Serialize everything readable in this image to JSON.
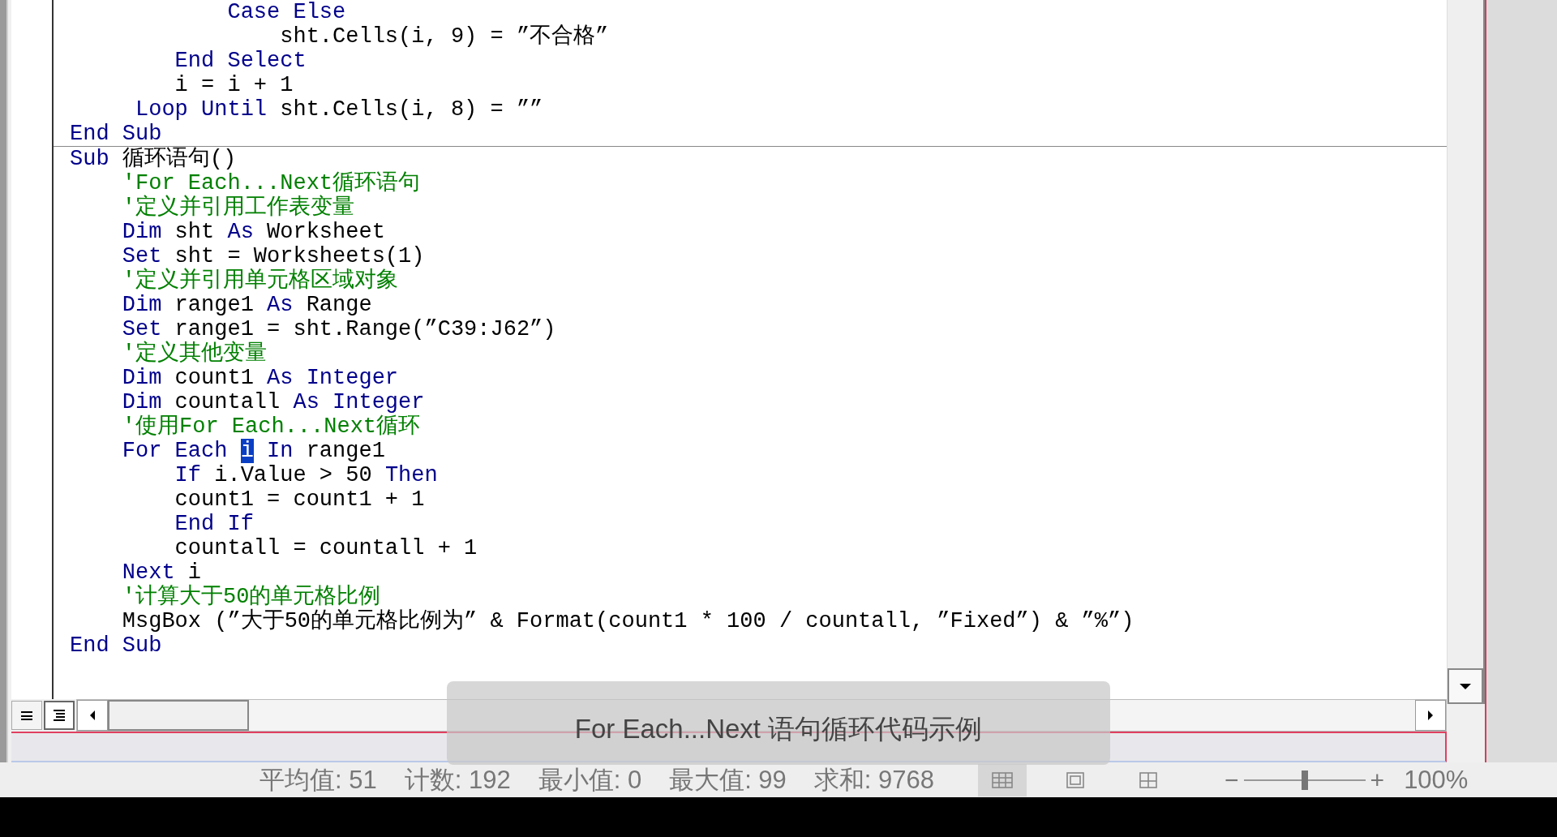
{
  "code_window": {
    "procedures": [
      {
        "lines": [
          [
            {
              "kind": "keyword",
              "text": "            Case Else"
            }
          ],
          [
            {
              "kind": "plain",
              "text": "                sht.Cells(i, 9) = ”不合格”"
            }
          ],
          [
            {
              "kind": "keyword",
              "text": "        End Select"
            }
          ],
          [
            {
              "kind": "plain",
              "text": "        i = i + 1"
            }
          ],
          [
            {
              "kind": "keyword",
              "text": "     Loop Until"
            },
            {
              "kind": "plain",
              "text": " sht.Cells(i, 8) = ””"
            }
          ],
          [
            {
              "kind": "keyword",
              "text": "End Sub"
            }
          ]
        ]
      },
      {
        "lines": [
          [
            {
              "kind": "keyword",
              "text": "Sub"
            },
            {
              "kind": "plain",
              "text": " 循环语句()"
            }
          ],
          [
            {
              "kind": "comment",
              "text": "    'For Each...Next循环语句"
            }
          ],
          [
            {
              "kind": "comment",
              "text": "    '定义并引用工作表变量"
            }
          ],
          [
            {
              "kind": "keyword",
              "text": "    Dim"
            },
            {
              "kind": "plain",
              "text": " sht "
            },
            {
              "kind": "keyword",
              "text": "As"
            },
            {
              "kind": "plain",
              "text": " Worksheet"
            }
          ],
          [
            {
              "kind": "keyword",
              "text": "    Set"
            },
            {
              "kind": "plain",
              "text": " sht = Worksheets(1)"
            }
          ],
          [
            {
              "kind": "comment",
              "text": "    '定义并引用单元格区域对象"
            }
          ],
          [
            {
              "kind": "keyword",
              "text": "    Dim"
            },
            {
              "kind": "plain",
              "text": " range1 "
            },
            {
              "kind": "keyword",
              "text": "As"
            },
            {
              "kind": "plain",
              "text": " Range"
            }
          ],
          [
            {
              "kind": "keyword",
              "text": "    Set"
            },
            {
              "kind": "plain",
              "text": " range1 = sht.Range(”C39:J62”)"
            }
          ],
          [
            {
              "kind": "comment",
              "text": "    '定义其他变量"
            }
          ],
          [
            {
              "kind": "keyword",
              "text": "    Dim"
            },
            {
              "kind": "plain",
              "text": " count1 "
            },
            {
              "kind": "keyword",
              "text": "As Integer"
            }
          ],
          [
            {
              "kind": "keyword",
              "text": "    Dim"
            },
            {
              "kind": "plain",
              "text": " countall "
            },
            {
              "kind": "keyword",
              "text": "As Integer"
            }
          ],
          [
            {
              "kind": "comment",
              "text": "    '使用For Each...Next循环"
            }
          ],
          [
            {
              "kind": "keyword",
              "text": "    For Each "
            },
            {
              "kind": "selection",
              "text": "i"
            },
            {
              "kind": "keyword",
              "text": " In"
            },
            {
              "kind": "plain",
              "text": " range1"
            }
          ],
          [
            {
              "kind": "keyword",
              "text": "        If"
            },
            {
              "kind": "plain",
              "text": " i.Value > 50 "
            },
            {
              "kind": "keyword",
              "text": "Then"
            }
          ],
          [
            {
              "kind": "plain",
              "text": "        count1 = count1 + 1"
            }
          ],
          [
            {
              "kind": "keyword",
              "text": "        End If"
            }
          ],
          [
            {
              "kind": "plain",
              "text": "        countall = countall + 1"
            }
          ],
          [
            {
              "kind": "keyword",
              "text": "    Next"
            },
            {
              "kind": "plain",
              "text": " i"
            }
          ],
          [
            {
              "kind": "comment",
              "text": "    '计算大于50的单元格比例"
            }
          ],
          [
            {
              "kind": "plain",
              "text": "    MsgBox (”大于50的单元格比例为” & Format(count1 * 100 / countall, ”Fixed”) & ”%”)"
            }
          ],
          [
            {
              "kind": "keyword",
              "text": "End Sub"
            }
          ]
        ]
      }
    ]
  },
  "view_buttons": [
    {
      "kind": "procedure",
      "selected": false
    },
    {
      "kind": "module",
      "selected": true
    }
  ],
  "caption": "For Each...Next 语句循环代码示例",
  "status_bar": {
    "stats": [
      "平均值: 51",
      "计数: 192",
      "最小值: 0",
      "最大值: 99",
      "求和: 9768"
    ],
    "views": [
      {
        "kind": "normal",
        "selected": true
      },
      {
        "kind": "page_layout",
        "selected": false
      },
      {
        "kind": "page_break",
        "selected": false
      }
    ],
    "zoom_out": "−",
    "zoom_in": "+",
    "zoom_slider": {
      "level": 0.5
    },
    "zoom": "100%"
  }
}
